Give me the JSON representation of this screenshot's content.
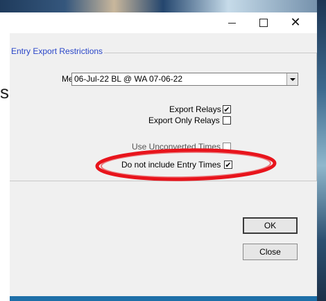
{
  "window": {
    "minimize_icon": "minimize-icon",
    "maximize_icon": "maximize-icon",
    "close_icon": "close-icon",
    "close_glyph": "✕"
  },
  "background": {
    "partial_text": "s"
  },
  "group": {
    "legend": "Entry Export Restrictions"
  },
  "meet": {
    "label": "Meet:",
    "value": "06-Jul-22 BL @ WA 07-06-22"
  },
  "options": {
    "export_relays": {
      "label": "Export Relays",
      "checked": true
    },
    "export_only_relays": {
      "label": "Export Only Relays",
      "checked": false
    },
    "use_unconverted_times": {
      "label": "Use Unconverted Times",
      "checked": false,
      "enabled": false
    },
    "no_entry_times": {
      "label": "Do not include Entry Times",
      "checked": true
    }
  },
  "buttons": {
    "ok": "OK",
    "close": "Close"
  },
  "colors": {
    "legend": "#2a46c8",
    "highlight_ellipse": "#e8141c",
    "dialog_bg": "#f0f0f0"
  },
  "check_glyph": "✔"
}
